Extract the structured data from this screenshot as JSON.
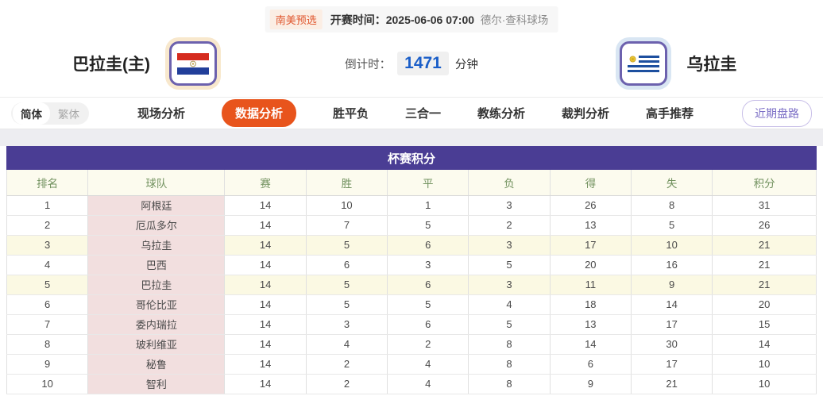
{
  "header": {
    "league_tag": "南美预选",
    "kickoff_label": "开赛时间：",
    "kickoff_time": "2025-06-06 07:00",
    "venue": "德尔·查科球场",
    "home_team": "巴拉圭(主)",
    "away_team": "乌拉圭",
    "countdown_label": "倒计时：",
    "countdown_value": "1471",
    "countdown_unit": "分钟"
  },
  "nav": {
    "lang_simplified": "简体",
    "lang_traditional": "繁体",
    "tabs": [
      {
        "id": "live-analysis",
        "label": "现场分析",
        "active": false
      },
      {
        "id": "data-analysis",
        "label": "数据分析",
        "active": true
      },
      {
        "id": "win-draw-loss",
        "label": "胜平负",
        "active": false
      },
      {
        "id": "three-in-one",
        "label": "三合一",
        "active": false
      },
      {
        "id": "coach-analysis",
        "label": "教练分析",
        "active": false
      },
      {
        "id": "referee-analysis",
        "label": "裁判分析",
        "active": false
      },
      {
        "id": "expert-recommend",
        "label": "高手推荐",
        "active": false
      }
    ],
    "recent_handicap_button": "近期盘路"
  },
  "standings": {
    "title": "杯赛积分",
    "columns": [
      "排名",
      "球队",
      "赛",
      "胜",
      "平",
      "负",
      "得",
      "失",
      "积分"
    ],
    "column_ids": [
      "rank",
      "team",
      "played",
      "win",
      "draw",
      "loss",
      "goals-for",
      "goals-against",
      "points"
    ],
    "rows": [
      {
        "values": [
          "1",
          "阿根廷",
          "14",
          "10",
          "1",
          "3",
          "26",
          "8",
          "31"
        ],
        "highlight": false
      },
      {
        "values": [
          "2",
          "厄瓜多尔",
          "14",
          "7",
          "5",
          "2",
          "13",
          "5",
          "26"
        ],
        "highlight": false
      },
      {
        "values": [
          "3",
          "乌拉圭",
          "14",
          "5",
          "6",
          "3",
          "17",
          "10",
          "21"
        ],
        "highlight": true
      },
      {
        "values": [
          "4",
          "巴西",
          "14",
          "6",
          "3",
          "5",
          "20",
          "16",
          "21"
        ],
        "highlight": false
      },
      {
        "values": [
          "5",
          "巴拉圭",
          "14",
          "5",
          "6",
          "3",
          "11",
          "9",
          "21"
        ],
        "highlight": true
      },
      {
        "values": [
          "6",
          "哥伦比亚",
          "14",
          "5",
          "5",
          "4",
          "18",
          "14",
          "20"
        ],
        "highlight": false
      },
      {
        "values": [
          "7",
          "委内瑞拉",
          "14",
          "3",
          "6",
          "5",
          "13",
          "17",
          "15"
        ],
        "highlight": false
      },
      {
        "values": [
          "8",
          "玻利维亚",
          "14",
          "4",
          "2",
          "8",
          "14",
          "30",
          "14"
        ],
        "highlight": false
      },
      {
        "values": [
          "9",
          "秘鲁",
          "14",
          "2",
          "4",
          "8",
          "6",
          "17",
          "10"
        ],
        "highlight": false
      },
      {
        "values": [
          "10",
          "智利",
          "14",
          "2",
          "4",
          "8",
          "9",
          "21",
          "10"
        ],
        "highlight": false
      }
    ]
  },
  "colors": {
    "accent_orange": "#e8541c",
    "title_purple": "#4a3d94",
    "flag_border_purple": "#6c61ae",
    "home_glow": "#f8e8cd",
    "away_glow": "#d9e6f3",
    "countdown_blue": "#1a5ec8",
    "header_green": "#71915e",
    "team_col_pink": "#f2dfdf",
    "highlight_cream": "#fbf9e3",
    "recent_btn_purple": "#7c6fc6"
  }
}
